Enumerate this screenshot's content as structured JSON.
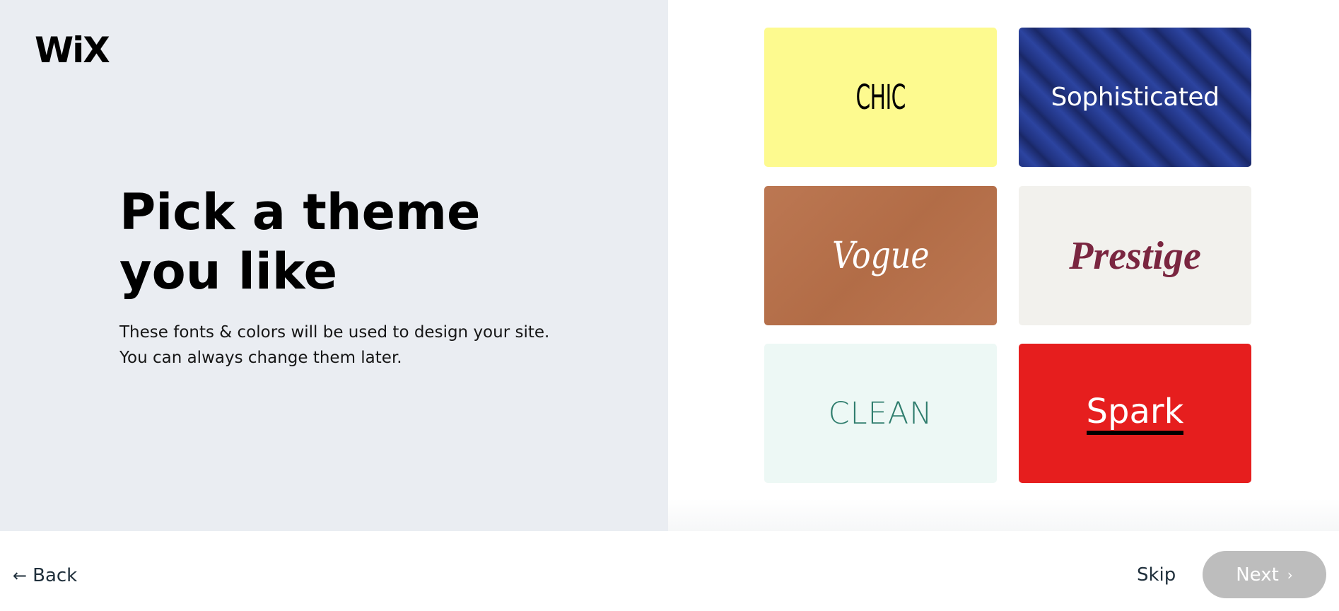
{
  "brand": {
    "logo_text": "WiX"
  },
  "intro": {
    "title": "Pick a theme you like",
    "subtitle_line1": "These fonts & colors will be used to design your site.",
    "subtitle_line2": "You can always change them later."
  },
  "themes": [
    {
      "name": "CHIC",
      "bg_color": "#fdfa8f",
      "text_color": "#000000"
    },
    {
      "name": "Sophisticated",
      "bg_color": "#263a8e",
      "text_color": "#ffffff"
    },
    {
      "name": "Vogue",
      "bg_color": "#b87049",
      "text_color": "#ffffff"
    },
    {
      "name": "Prestige",
      "bg_color": "#f2f1ed",
      "text_color": "#7a2640"
    },
    {
      "name": "CLEAN",
      "bg_color": "#edf8f5",
      "text_color": "#2f7d6d"
    },
    {
      "name": "Spark",
      "bg_color": "#e61e1e",
      "text_color": "#ffffff"
    }
  ],
  "footer": {
    "back_label": "Back",
    "back_icon": "arrow-left-icon",
    "skip_label": "Skip",
    "next_label": "Next",
    "next_icon": "chevron-right-icon",
    "next_disabled": true
  }
}
